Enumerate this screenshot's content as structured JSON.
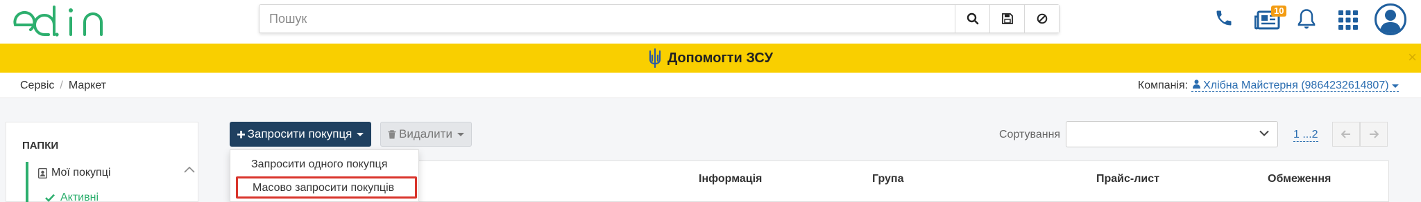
{
  "header": {
    "logo_text": "edin",
    "search": {
      "placeholder": "Пошук",
      "value": ""
    },
    "search_buttons": [
      "search-icon",
      "save-icon",
      "cancel-icon"
    ],
    "icons": [
      "phone-icon",
      "news-icon",
      "bell-icon",
      "apps-grid-icon",
      "user-avatar-icon"
    ],
    "news_badge": "10"
  },
  "banner": {
    "icon": "trident-icon",
    "text": "Допомогти ЗСУ",
    "close": "×"
  },
  "breadcrumb": {
    "items": [
      "Сервіс",
      "Маркет"
    ],
    "separator": "/"
  },
  "company": {
    "label": "Компанія:",
    "name": "Хлібна Майстерня (9864232614807)"
  },
  "sidebar": {
    "title": "ПАПКИ",
    "folder": "Мої покупці",
    "sub_item": "Активні"
  },
  "toolbar": {
    "invite_label": "Запросити покупця",
    "delete_label": "Видалити",
    "sort_label": "Сортування",
    "sort_value": "",
    "pages": "1 ...2"
  },
  "dropdown": {
    "items": [
      "Запросити одного покупця",
      "Масово запросити покупців"
    ]
  },
  "table": {
    "columns": [
      "Інформація",
      "Група",
      "Прайс-лист",
      "Обмеження"
    ]
  },
  "colors": {
    "brand_green": "#2daf6e",
    "banner_yellow": "#f9cf00",
    "primary_button": "#1f4060",
    "link_blue": "#2a6db0",
    "highlight_red": "#d9342b",
    "badge_orange": "#f39c12"
  }
}
